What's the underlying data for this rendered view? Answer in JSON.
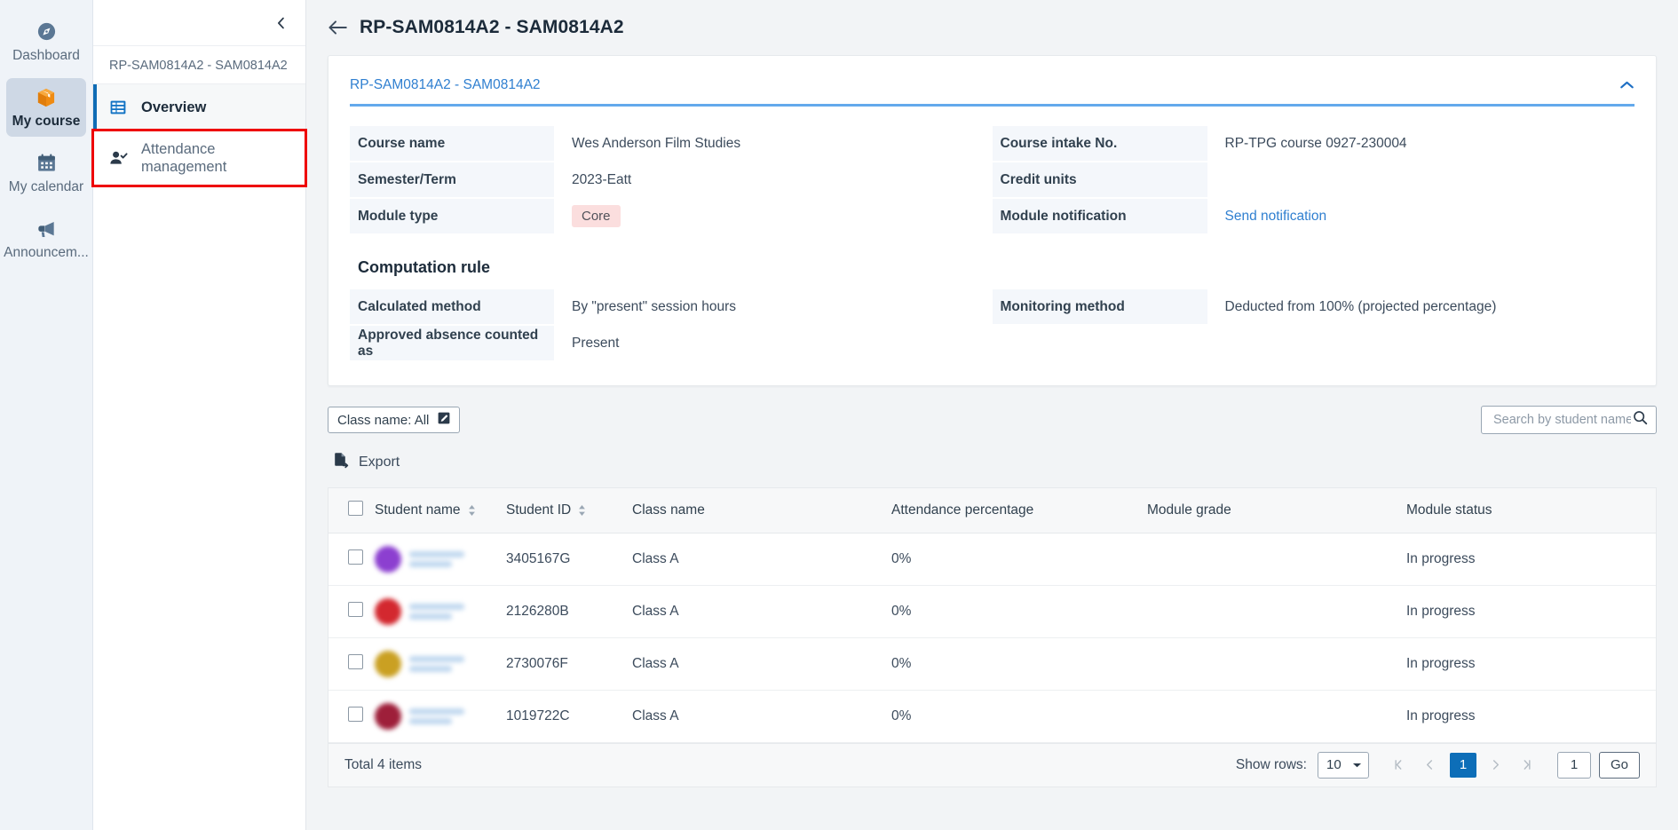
{
  "rail": {
    "items": [
      {
        "label": "Dashboard",
        "icon": "compass-icon",
        "active": false
      },
      {
        "label": "My course",
        "icon": "box-icon",
        "active": true
      },
      {
        "label": "My calendar",
        "icon": "calendar-icon",
        "active": false
      },
      {
        "label": "Announcem...",
        "icon": "megaphone-icon",
        "active": false
      }
    ]
  },
  "subnav": {
    "collapse_icon": "chevron-left-icon",
    "course_code": "RP-SAM0814A2 - SAM0814A2",
    "items": [
      {
        "label": "Overview",
        "icon": "list-icon"
      },
      {
        "label": "Attendance management",
        "icon": "user-check-icon"
      }
    ]
  },
  "header": {
    "back_icon": "arrow-left-icon",
    "title": "RP-SAM0814A2 - SAM0814A2"
  },
  "card": {
    "link": "RP-SAM0814A2 - SAM0814A2",
    "collapse_icon": "chevron-up-icon",
    "accent_color": "#63a9ec",
    "left_rows": [
      {
        "key": "Course name",
        "value": "Wes Anderson Film Studies",
        "type": "text"
      },
      {
        "key": "Semester/Term",
        "value": "2023-Eatt",
        "type": "text"
      },
      {
        "key": "Module type",
        "value": "Core",
        "type": "pill",
        "pill_bg": "#fbdede"
      }
    ],
    "right_rows": [
      {
        "key": "Course intake No.",
        "value": "RP-TPG course 0927-230004",
        "type": "text"
      },
      {
        "key": "Credit units",
        "value": "",
        "type": "text"
      },
      {
        "key": "Module notification",
        "value": "Send notification",
        "type": "link"
      }
    ],
    "section_title": "Computation rule",
    "rule_left_rows": [
      {
        "key": "Calculated method",
        "value": "By \"present\" session hours",
        "type": "text"
      },
      {
        "key": "Approved absence counted as",
        "value": "Present",
        "type": "text"
      }
    ],
    "rule_right_rows": [
      {
        "key": "Monitoring method",
        "value": "Deducted from 100% (projected percentage)",
        "type": "text"
      }
    ]
  },
  "filters": {
    "class_chip": "Class name: All",
    "class_chip_icon": "edit-square-icon",
    "search_placeholder": "Search by student name or ID",
    "search_value": "",
    "search_icon": "search-icon",
    "export_label": "Export",
    "export_icon": "file-export-icon"
  },
  "table": {
    "columns": [
      {
        "label": "",
        "key": "check",
        "sortable": false
      },
      {
        "label": "Student name",
        "key": "name",
        "sortable": true
      },
      {
        "label": "Student ID",
        "key": "id",
        "sortable": true
      },
      {
        "label": "Class name",
        "key": "class",
        "sortable": false
      },
      {
        "label": "Attendance percentage",
        "key": "attendance",
        "sortable": false
      },
      {
        "label": "Module grade",
        "key": "grade",
        "sortable": false
      },
      {
        "label": "Module status",
        "key": "status",
        "sortable": false
      }
    ],
    "rows": [
      {
        "name": "",
        "avatar_color": "#8c3fd0",
        "id": "3405167G",
        "class": "Class A",
        "attendance": "0%",
        "grade": "",
        "status": "In progress"
      },
      {
        "name": "",
        "avatar_color": "#d3282f",
        "id": "2126280B",
        "class": "Class A",
        "attendance": "0%",
        "grade": "",
        "status": "In progress"
      },
      {
        "name": "",
        "avatar_color": "#caa022",
        "id": "2730076F",
        "class": "Class A",
        "attendance": "0%",
        "grade": "",
        "status": "In progress"
      },
      {
        "name": "",
        "avatar_color": "#9e1f3a",
        "id": "1019722C",
        "class": "Class A",
        "attendance": "0%",
        "grade": "",
        "status": "In progress"
      }
    ]
  },
  "footer": {
    "total": "Total 4 items",
    "show_rows_label": "Show rows:",
    "rows_per_page": "10",
    "first_icon": "page-first-icon",
    "prev_icon": "chevron-left-icon",
    "current_page": "1",
    "next_icon": "chevron-right-icon",
    "last_icon": "page-last-icon",
    "goto_value": "1",
    "go_label": "Go"
  }
}
